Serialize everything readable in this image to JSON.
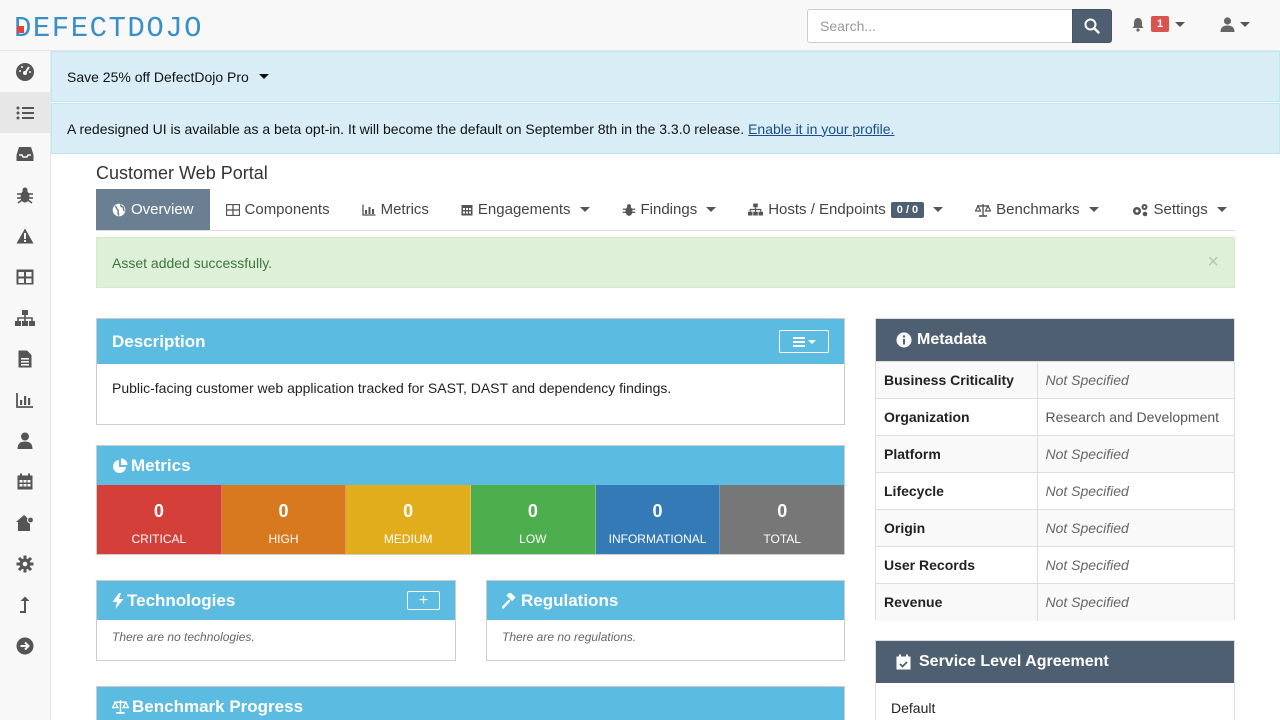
{
  "brand": "DEFECTDOJO",
  "search": {
    "placeholder": "Search..."
  },
  "notifications": {
    "count": "1"
  },
  "sidebar": {
    "items": [
      "dashboard-icon",
      "list-icon",
      "inbox-icon",
      "bug-icon",
      "warning-icon",
      "table-icon",
      "sitemap-icon",
      "document-icon",
      "chart-icon",
      "user-icon",
      "calendar-icon",
      "home-gear-icon",
      "gear-icon",
      "level-up-icon",
      "arrow-circle-right-icon"
    ]
  },
  "promo": {
    "text": "Save 25% off DefectDojo Pro"
  },
  "beta": {
    "text": "A redesigned UI is available as a beta opt-in. It will become the default on September 8th in the 3.3.0 release.",
    "link": "Enable it in your profile."
  },
  "product": {
    "title": "Customer Web Portal"
  },
  "tabs": {
    "overview": "Overview",
    "components": "Components",
    "metrics": "Metrics",
    "engagements": "Engagements",
    "findings": "Findings",
    "hosts": "Hosts / Endpoints",
    "hosts_badge": "0 / 0",
    "benchmarks": "Benchmarks",
    "settings": "Settings"
  },
  "alert": {
    "text": "Asset added successfully.",
    "close": "×"
  },
  "description": {
    "title": "Description",
    "text": "Public-facing customer web application tracked for SAST, DAST and dependency findings."
  },
  "metrics": {
    "title": "Metrics",
    "cells": [
      {
        "value": "0",
        "label": "CRITICAL",
        "color": "#d43f3a"
      },
      {
        "value": "0",
        "label": "HIGH",
        "color": "#d9791f"
      },
      {
        "value": "0",
        "label": "MEDIUM",
        "color": "#e2ad1d"
      },
      {
        "value": "0",
        "label": "LOW",
        "color": "#4cae4c"
      },
      {
        "value": "0",
        "label": "INFORMATIONAL",
        "color": "#337ab7"
      },
      {
        "value": "0",
        "label": "TOTAL",
        "color": "#777777"
      }
    ]
  },
  "technologies": {
    "title": "Technologies",
    "empty": "There are no technologies.",
    "add": "+"
  },
  "regulations": {
    "title": "Regulations",
    "empty": "There are no regulations."
  },
  "benchmark": {
    "title": "Benchmark Progress"
  },
  "metadata": {
    "title": "Metadata",
    "rows": [
      {
        "key": "Business Criticality",
        "value": "Not Specified"
      },
      {
        "key": "Organization",
        "value": "Research and Development"
      },
      {
        "key": "Platform",
        "value": "Not Specified"
      },
      {
        "key": "Lifecycle",
        "value": "Not Specified"
      },
      {
        "key": "Origin",
        "value": "Not Specified"
      },
      {
        "key": "User Records",
        "value": "Not Specified"
      },
      {
        "key": "Revenue",
        "value": "Not Specified"
      }
    ]
  },
  "sla": {
    "title": "Service Level Agreement",
    "value": "Default"
  },
  "colors": {
    "accent": "#5bbbe0",
    "dark": "#4f5f72",
    "brand": "#3a8fc9"
  }
}
